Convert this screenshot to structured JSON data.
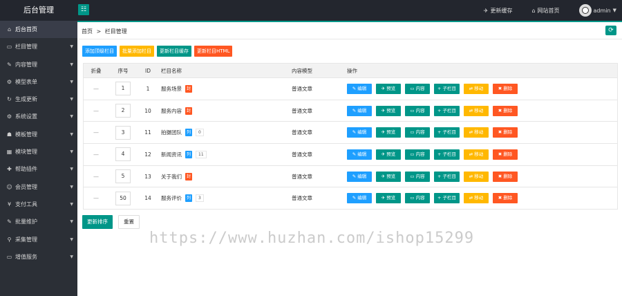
{
  "app": {
    "brand": "后台管理",
    "menu_toggle": "☷",
    "top_links": [
      {
        "icon": "✈",
        "label": "更新缓存"
      },
      {
        "icon": "⌂",
        "label": "网站首页"
      }
    ],
    "user": {
      "name": "admin"
    }
  },
  "sidebar": {
    "items": [
      {
        "icon": "⌂",
        "label": "后台首页",
        "active": true,
        "arrow": ""
      },
      {
        "icon": "▭",
        "label": "栏目管理",
        "arrow": "▼"
      },
      {
        "icon": "✎",
        "label": "内容管理",
        "arrow": "▼"
      },
      {
        "icon": "⚙",
        "label": "模型表单",
        "arrow": "▼"
      },
      {
        "icon": "↻",
        "label": "生成更新",
        "arrow": "▼"
      },
      {
        "icon": "⚙",
        "label": "系统设置",
        "arrow": "▼"
      },
      {
        "icon": "☗",
        "label": "模板管理",
        "arrow": "▼"
      },
      {
        "icon": "▦",
        "label": "模块管理",
        "arrow": "▼"
      },
      {
        "icon": "✚",
        "label": "帮助插件",
        "arrow": "▼"
      },
      {
        "icon": "☺",
        "label": "会员管理",
        "arrow": "▼"
      },
      {
        "icon": "¥",
        "label": "支付工具",
        "arrow": "▼"
      },
      {
        "icon": "✎",
        "label": "批量维护",
        "arrow": "▼"
      },
      {
        "icon": "⚲",
        "label": "采集管理",
        "arrow": "▼"
      },
      {
        "icon": "▭",
        "label": "增值服务",
        "arrow": "▼"
      }
    ]
  },
  "breadcrumb": {
    "home": "首页",
    "sep": ">",
    "current": "栏目管理"
  },
  "refresh_icon": "⟳",
  "toolbar": [
    {
      "label": "添加顶级栏目",
      "color": "blue"
    },
    {
      "label": "批量添加栏目",
      "color": "orange"
    },
    {
      "label": "更新栏目缓存",
      "color": "teal"
    },
    {
      "label": "更新栏目HTML",
      "color": "red"
    }
  ],
  "table": {
    "headers": {
      "fold": "折叠",
      "order": "序号",
      "id": "ID",
      "name": "栏目名称",
      "model": "内容模型",
      "ops": "操作"
    },
    "rows": [
      {
        "fold": "—",
        "order": "1",
        "id": "1",
        "name": "服务场景",
        "tag": "封",
        "tag_color": "red",
        "count": "",
        "model": "普通文章"
      },
      {
        "fold": "—",
        "order": "2",
        "id": "10",
        "name": "服务内容",
        "tag": "封",
        "tag_color": "red",
        "count": "",
        "model": "普通文章"
      },
      {
        "fold": "—",
        "order": "3",
        "id": "11",
        "name": "拍摄团队",
        "tag": "列",
        "tag_color": "blue",
        "count": "0",
        "model": "普通文章"
      },
      {
        "fold": "—",
        "order": "4",
        "id": "12",
        "name": "新闻资讯",
        "tag": "列",
        "tag_color": "blue",
        "count": "11",
        "model": "普通文章"
      },
      {
        "fold": "—",
        "order": "5",
        "id": "13",
        "name": "关于我们",
        "tag": "封",
        "tag_color": "red",
        "count": "",
        "model": "普通文章"
      },
      {
        "fold": "—",
        "order": "50",
        "id": "14",
        "name": "服务评价",
        "tag": "列",
        "tag_color": "blue",
        "count": "3",
        "model": "普通文章"
      }
    ],
    "ops": [
      {
        "icon": "✎",
        "label": "编辑",
        "color": "blue"
      },
      {
        "icon": "✈",
        "label": "预览",
        "color": "teal"
      },
      {
        "icon": "▭",
        "label": "内容",
        "color": "teal"
      },
      {
        "icon": "+",
        "label": "子栏目",
        "color": "teal"
      },
      {
        "icon": "⇄",
        "label": "移动",
        "color": "orange"
      },
      {
        "icon": "✖",
        "label": "删除",
        "color": "red"
      }
    ]
  },
  "bottom": {
    "update_order": "更新排序",
    "reset": "重置"
  },
  "watermark": "https://www.huzhan.com/ishop15299",
  "colors": {
    "teal": "#009688",
    "blue": "#1e9fff",
    "orange": "#ffb800",
    "red": "#ff5722",
    "dark": "#23262e"
  }
}
